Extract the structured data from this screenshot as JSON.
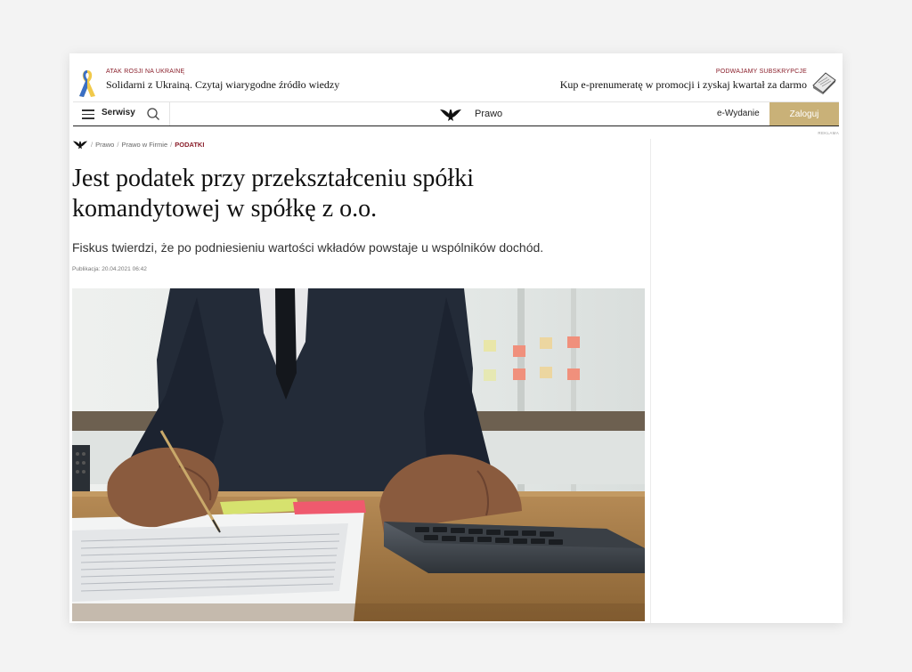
{
  "banner": {
    "left_kicker": "ATAK ROSJI NA UKRAINĘ",
    "left_title": "Solidarni z Ukrainą. Czytaj wiarygodne źródło wiedzy",
    "right_kicker": "PODWAJAMY SUBSKRYPCJE",
    "right_title": "Kup e-prenumeratę w promocji i zyskaj kwartał za darmo"
  },
  "nav": {
    "serwisy": "Serwisy",
    "section": "Prawo",
    "e_wydanie": "e-Wydanie",
    "login": "Zaloguj"
  },
  "ad_label": "REKLAMA",
  "breadcrumb": {
    "items": [
      "Prawo",
      "Prawo w Firmie"
    ],
    "current": "PODATKI"
  },
  "article": {
    "title": "Jest podatek przy przekształceniu spółki komandytowej w spółkę z o.o.",
    "lead": "Fiskus twierdzi, że po podniesieniu wartości wkładów powstaje u wspólników dochód.",
    "published": "Publikacja: 20.04.2021 06:42"
  },
  "colors": {
    "accent_gold": "#c9b178",
    "kicker_red": "#8a1f2b"
  },
  "icons": [
    "ukraine-ribbon-icon",
    "hamburger-icon",
    "search-icon",
    "eagle-logo-icon",
    "book-icon"
  ]
}
